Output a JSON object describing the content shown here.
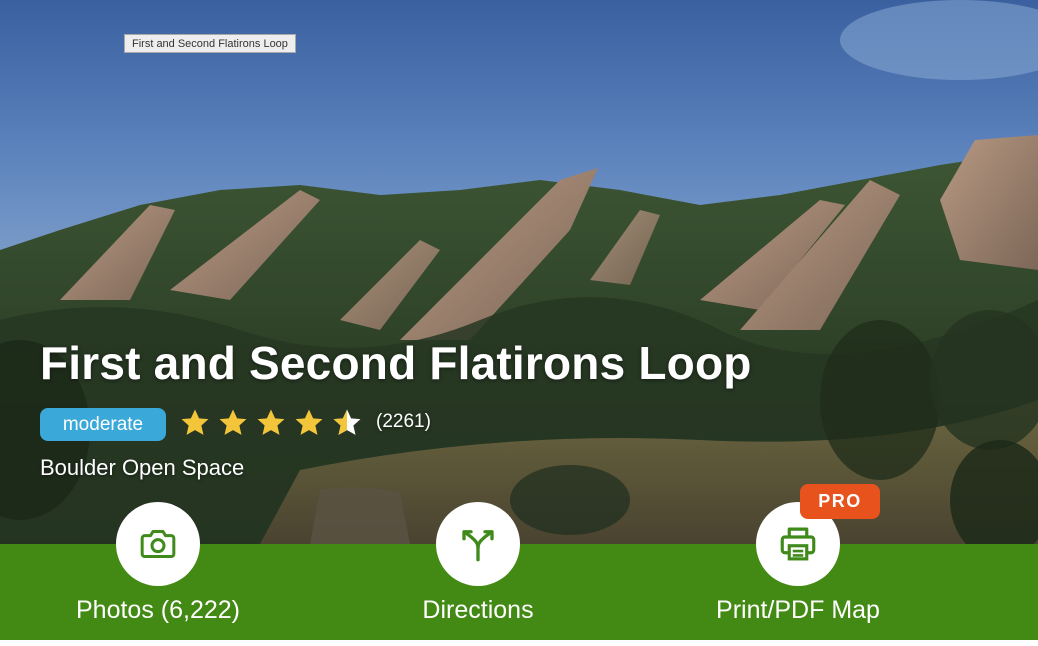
{
  "tooltip": {
    "text": "First and Second Flatirons Loop"
  },
  "trail": {
    "title": "First and Second Flatirons Loop",
    "difficulty": "moderate",
    "rating": 4.5,
    "rating_max": 5,
    "review_count": "(2261)",
    "park": "Boulder Open Space"
  },
  "colors": {
    "action_bar": "#428a13",
    "difficulty_badge": "#3aa8d8",
    "pro_badge": "#e8521d",
    "star": "#f3c53a"
  },
  "actions": [
    {
      "label": "Photos (6,222)",
      "icon": "camera-icon"
    },
    {
      "label": "Directions",
      "icon": "directions-icon"
    },
    {
      "label": "Print/PDF Map",
      "icon": "printer-icon",
      "badge": "PRO"
    }
  ]
}
